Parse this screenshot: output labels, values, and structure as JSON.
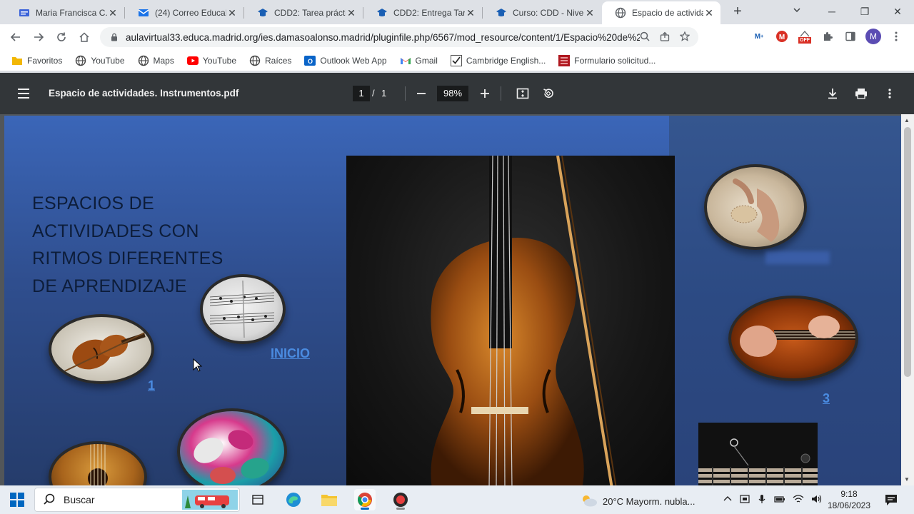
{
  "browser": {
    "tabs": [
      {
        "title": "Maria Francisca C...",
        "icon": "form-icon",
        "active": false
      },
      {
        "title": "(24) Correo EducaM...",
        "icon": "mail-icon",
        "active": false
      },
      {
        "title": "CDD2: Tarea práctic...",
        "icon": "moodle-icon",
        "active": false
      },
      {
        "title": "CDD2: Entrega Tare...",
        "icon": "moodle-icon",
        "active": false
      },
      {
        "title": "Curso: CDD - Nivel ...",
        "icon": "moodle-icon",
        "active": false
      },
      {
        "title": "Espacio de actividad...",
        "icon": "globe-icon",
        "active": true
      }
    ],
    "new_tab_label": "+",
    "url": "aulavirtual33.educa.madrid.org/ies.damasoalonso.madrid/pluginfile.php/6567/mod_resource/content/1/Espacio%20de%20...",
    "ext_badge": "OFF",
    "avatar_letter": "M"
  },
  "bookmarks": [
    {
      "label": "Favoritos",
      "icon": "folder-icon"
    },
    {
      "label": "YouTube",
      "icon": "globe-icon"
    },
    {
      "label": "Maps",
      "icon": "globe-icon"
    },
    {
      "label": "YouTube",
      "icon": "youtube-icon"
    },
    {
      "label": "Raíces",
      "icon": "globe-icon"
    },
    {
      "label": "Outlook Web App",
      "icon": "outlook-icon"
    },
    {
      "label": "Gmail",
      "icon": "gmail-icon"
    },
    {
      "label": "Cambridge English...",
      "icon": "check-icon"
    },
    {
      "label": "Formulario solicitud...",
      "icon": "form-red-icon"
    }
  ],
  "pdf": {
    "title": "Espacio de actividades. Instrumentos.pdf",
    "page_current": "1",
    "page_sep": "/",
    "page_total": "1",
    "zoom": "98%"
  },
  "slide": {
    "title_lines": [
      "ESPACIOS DE",
      "ACTIVIDADES CON",
      "RITMOS DIFERENTES",
      "DE APRENDIZAJE"
    ],
    "link_inicio": "INICIO",
    "link_1": "1",
    "link_3": "3"
  },
  "taskbar": {
    "search_placeholder": "Buscar",
    "weather": "20°C  Mayorm. nubla...",
    "time": "9:18",
    "date": "18/06/2023"
  }
}
